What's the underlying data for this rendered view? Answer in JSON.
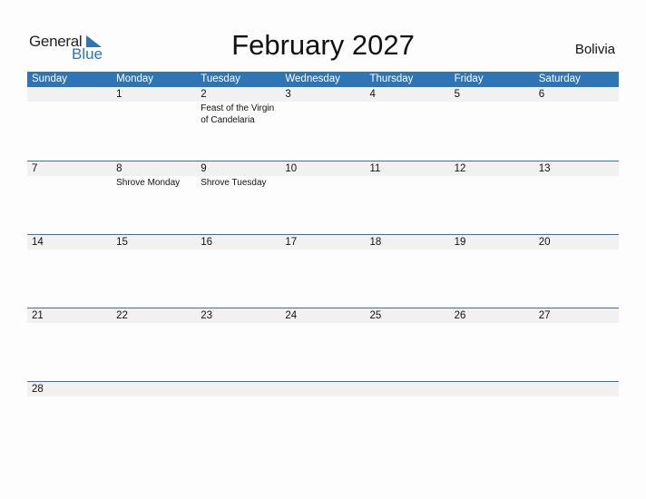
{
  "logo": {
    "general": "General",
    "blue": "Blue"
  },
  "title": "February 2027",
  "country": "Bolivia",
  "weekdays": [
    "Sunday",
    "Monday",
    "Tuesday",
    "Wednesday",
    "Thursday",
    "Friday",
    "Saturday"
  ],
  "weeks": [
    [
      {
        "d": "",
        "e": ""
      },
      {
        "d": "1",
        "e": ""
      },
      {
        "d": "2",
        "e": "Feast of the Virgin of Candelaria"
      },
      {
        "d": "3",
        "e": ""
      },
      {
        "d": "4",
        "e": ""
      },
      {
        "d": "5",
        "e": ""
      },
      {
        "d": "6",
        "e": ""
      }
    ],
    [
      {
        "d": "7",
        "e": ""
      },
      {
        "d": "8",
        "e": "Shrove Monday"
      },
      {
        "d": "9",
        "e": "Shrove Tuesday"
      },
      {
        "d": "10",
        "e": ""
      },
      {
        "d": "11",
        "e": ""
      },
      {
        "d": "12",
        "e": ""
      },
      {
        "d": "13",
        "e": ""
      }
    ],
    [
      {
        "d": "14",
        "e": ""
      },
      {
        "d": "15",
        "e": ""
      },
      {
        "d": "16",
        "e": ""
      },
      {
        "d": "17",
        "e": ""
      },
      {
        "d": "18",
        "e": ""
      },
      {
        "d": "19",
        "e": ""
      },
      {
        "d": "20",
        "e": ""
      }
    ],
    [
      {
        "d": "21",
        "e": ""
      },
      {
        "d": "22",
        "e": ""
      },
      {
        "d": "23",
        "e": ""
      },
      {
        "d": "24",
        "e": ""
      },
      {
        "d": "25",
        "e": ""
      },
      {
        "d": "26",
        "e": ""
      },
      {
        "d": "27",
        "e": ""
      }
    ],
    [
      {
        "d": "28",
        "e": ""
      },
      {
        "d": "",
        "e": ""
      },
      {
        "d": "",
        "e": ""
      },
      {
        "d": "",
        "e": ""
      },
      {
        "d": "",
        "e": ""
      },
      {
        "d": "",
        "e": ""
      },
      {
        "d": "",
        "e": ""
      }
    ]
  ],
  "colors": {
    "accent": "#2e75b6",
    "strip": "#f1f1f1"
  }
}
